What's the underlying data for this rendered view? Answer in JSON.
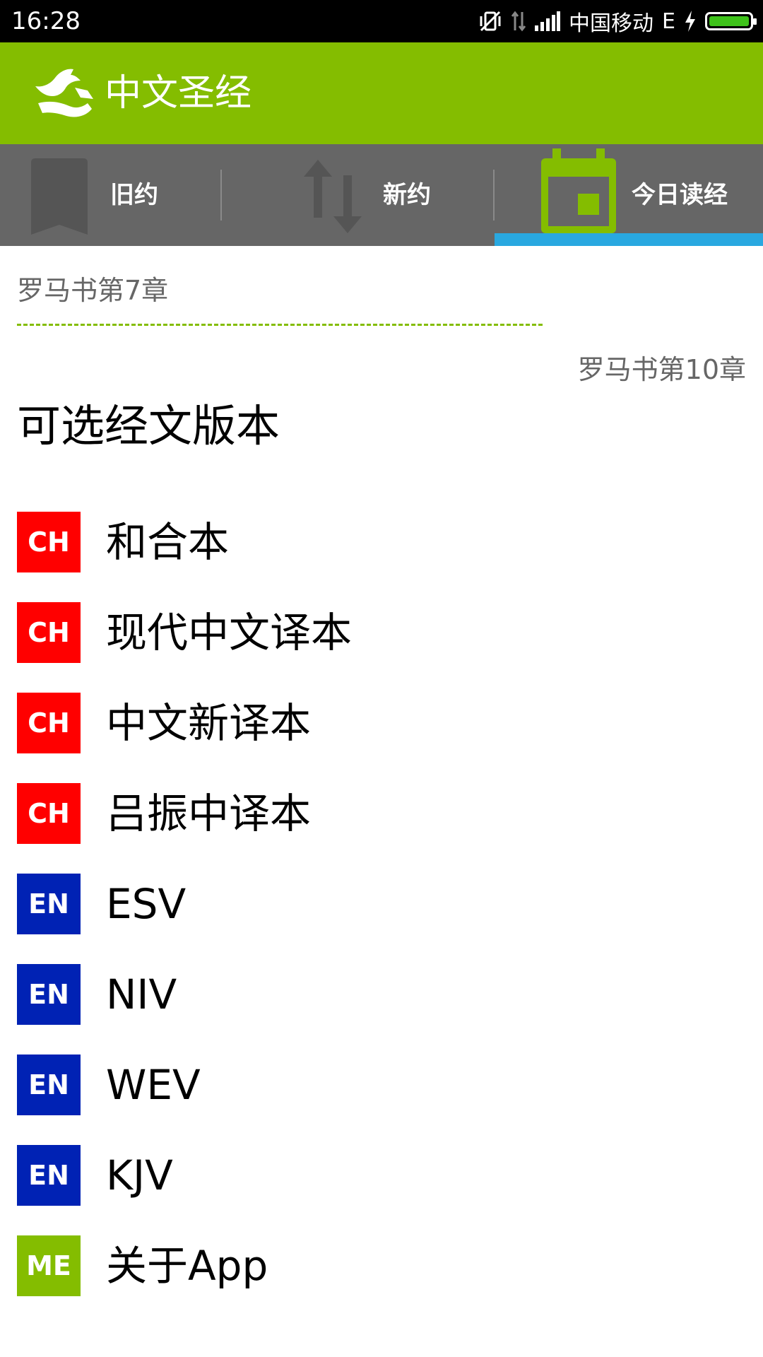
{
  "status_bar": {
    "time": "16:28",
    "carrier": "中国移动",
    "network_type": "E",
    "icons": [
      "vibrate-off-icon",
      "data-transfer-icon",
      "signal-icon",
      "charging-icon",
      "battery-icon"
    ],
    "battery_color": "#3ec21a"
  },
  "app_bar": {
    "title": "中文圣经",
    "logo": "dove-hand-logo",
    "background": "#84bd00"
  },
  "tabs": [
    {
      "label": "旧约",
      "icon": "bookmark-icon",
      "selected": false
    },
    {
      "label": "新约",
      "icon": "swap-vertical-icon",
      "selected": false
    },
    {
      "label": "今日读经",
      "icon": "calendar-icon",
      "selected": true
    }
  ],
  "tab_indicator_color": "#29a8e0",
  "navigation": {
    "prev_chapter": "罗马书第7章",
    "next_chapter": "罗马书第10章"
  },
  "section_title": "可选经文版本",
  "versions": [
    {
      "badge": "CH",
      "name": "和合本",
      "badge_color": "#ff0000"
    },
    {
      "badge": "CH",
      "name": "现代中文译本",
      "badge_color": "#ff0000"
    },
    {
      "badge": "CH",
      "name": "中文新译本",
      "badge_color": "#ff0000"
    },
    {
      "badge": "CH",
      "name": "吕振中译本",
      "badge_color": "#ff0000"
    },
    {
      "badge": "EN",
      "name": "ESV",
      "badge_color": "#0022b4"
    },
    {
      "badge": "EN",
      "name": "NIV",
      "badge_color": "#0022b4"
    },
    {
      "badge": "EN",
      "name": "WEV",
      "badge_color": "#0022b4"
    },
    {
      "badge": "EN",
      "name": "KJV",
      "badge_color": "#0022b4"
    },
    {
      "badge": "ME",
      "name": "关于App",
      "badge_color": "#84bd00"
    }
  ]
}
